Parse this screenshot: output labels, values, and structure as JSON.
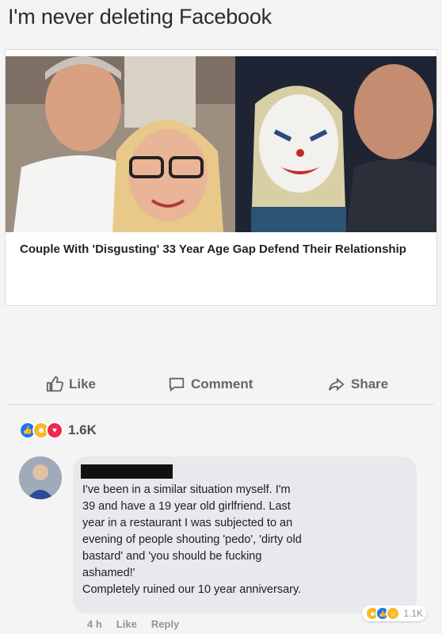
{
  "caption": "I'm never deleting Facebook",
  "post": {
    "headline": "Couple With 'Disgusting' 33 Year Age Gap Defend Their Relationship",
    "actions": {
      "like": "Like",
      "comment": "Comment",
      "share": "Share"
    },
    "reactions": {
      "count": "1.6K",
      "types": [
        "like-reaction",
        "haha-reaction",
        "love-reaction"
      ]
    }
  },
  "comment": {
    "text": "I've been in a similar situation  myself. I'm\n39 and have a 19 year old girlfriend. Last\nyear in a restaurant I was subjected to an\nevening of people shouting 'pedo', 'dirty old\nbastard' and 'you should be fucking\nashamed!'\nCompletely ruined our 10 year anniversary.",
    "reaction_count": "1.1K",
    "meta": {
      "time": "4 h",
      "like": "Like",
      "reply": "Reply"
    }
  },
  "colors": {
    "like_blue": "#1877f2",
    "love_red": "#f0284a",
    "haha_yellow": "#f7b928"
  }
}
